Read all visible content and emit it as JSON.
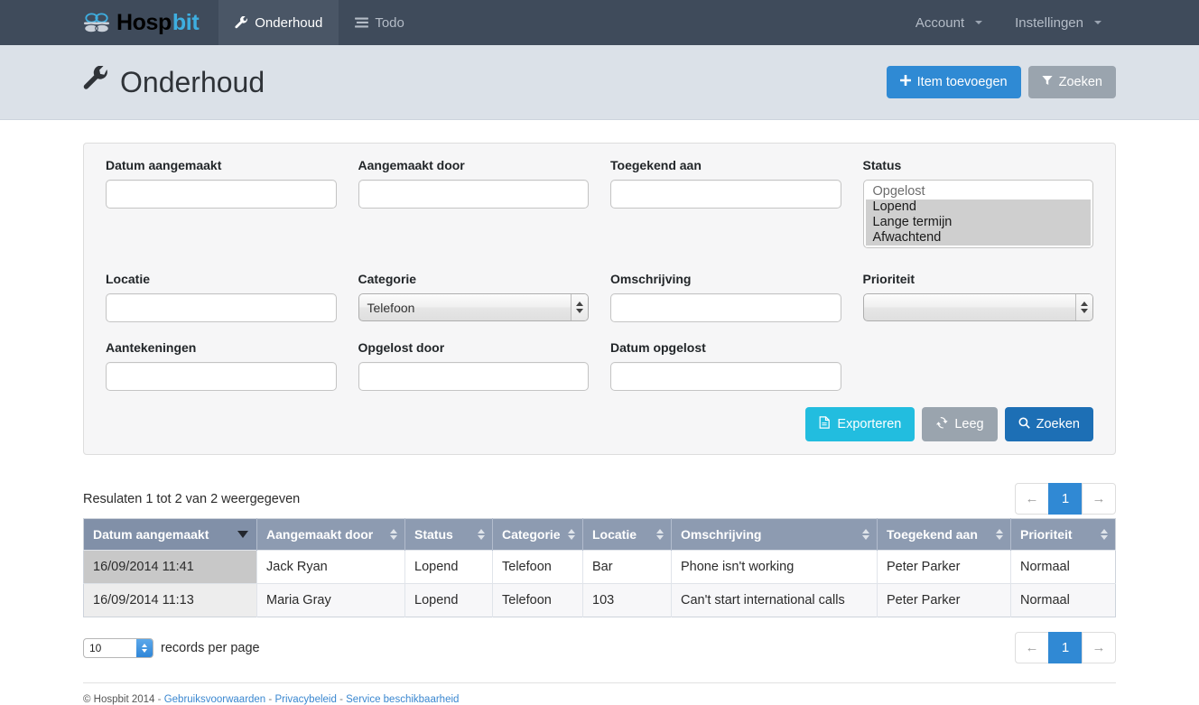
{
  "navbar": {
    "brand": {
      "name_a": "Hosp",
      "name_b": "bit",
      "icon": "hospital-bed-icon"
    },
    "items": [
      {
        "label": "Onderhoud",
        "icon": "wrench-icon",
        "active": true
      },
      {
        "label": "Todo",
        "icon": "list-icon",
        "active": false
      }
    ],
    "right_items": [
      {
        "label": "Account",
        "icon": "caret-down-icon"
      },
      {
        "label": "Instellingen",
        "icon": "caret-down-icon"
      }
    ],
    "bg_color": "#3f4b5b",
    "active_bg_color": "#4a5666"
  },
  "page_header": {
    "title": "Onderhoud",
    "icon": "wrench-icon",
    "add_button": {
      "label": "Item toevoegen",
      "icon": "plus-icon",
      "color": "#2f8ad4"
    },
    "search_button": {
      "label": "Zoeken",
      "icon": "filter-icon",
      "color": "#9aa4ae"
    }
  },
  "filters": {
    "row1": [
      {
        "label": "Datum aangemaakt",
        "value": "",
        "placeholder": "",
        "type": "text",
        "name": "datum-aangemaakt"
      },
      {
        "label": "Aangemaakt door",
        "value": "",
        "placeholder": "",
        "type": "text",
        "name": "aangemaakt-door"
      },
      {
        "label": "Toegekend aan",
        "value": "",
        "placeholder": "",
        "type": "text",
        "name": "toegekend-aan"
      }
    ],
    "status": {
      "label": "Status",
      "type": "multiselect",
      "options": [
        {
          "label": "Opgelost",
          "selected": false
        },
        {
          "label": "Lopend",
          "selected": true
        },
        {
          "label": "Lange termijn",
          "selected": true
        },
        {
          "label": "Afwachtend",
          "selected": true
        }
      ]
    },
    "row2": [
      {
        "label": "Locatie",
        "value": "",
        "type": "text",
        "name": "locatie"
      },
      {
        "label": "Categorie",
        "value": "Telefoon",
        "type": "select",
        "name": "categorie"
      },
      {
        "label": "Omschrijving",
        "value": "",
        "type": "text",
        "name": "omschrijving"
      },
      {
        "label": "Prioriteit",
        "value": "",
        "type": "select",
        "name": "prioriteit"
      }
    ],
    "row3": [
      {
        "label": "Aantekeningen",
        "value": "",
        "type": "text",
        "name": "aantekeningen"
      },
      {
        "label": "Opgelost door",
        "value": "",
        "type": "text",
        "name": "opgelost-door"
      },
      {
        "label": "Datum opgelost",
        "value": "",
        "type": "text",
        "name": "datum-opgelost"
      }
    ],
    "actions": [
      {
        "label": "Exporteren",
        "icon": "pdf-file-icon",
        "color": "#22bddf"
      },
      {
        "label": "Leeg",
        "icon": "refresh-icon",
        "color": "#9aa4ae"
      },
      {
        "label": "Zoeken",
        "icon": "magnifier-icon",
        "color": "#1d6fb5"
      }
    ]
  },
  "results": {
    "summary": "Resulaten 1 tot 2 van 2 weergegeven",
    "pager": {
      "prev": "←",
      "current": "1",
      "next": "→"
    },
    "records_per_page": {
      "value": "10",
      "label": "records per page"
    }
  },
  "table": {
    "columns": [
      {
        "label": "Datum aangemaakt",
        "sort": "desc"
      },
      {
        "label": "Aangemaakt door",
        "sort": "none"
      },
      {
        "label": "Status",
        "sort": "none"
      },
      {
        "label": "Categorie",
        "sort": "none"
      },
      {
        "label": "Locatie",
        "sort": "none"
      },
      {
        "label": "Omschrijving",
        "sort": "none"
      },
      {
        "label": "Toegekend aan",
        "sort": "none"
      },
      {
        "label": "Prioriteit",
        "sort": "none"
      }
    ],
    "rows": [
      [
        "16/09/2014 11:41",
        "Jack Ryan",
        "Lopend",
        "Telefoon",
        "Bar",
        "Phone isn't working",
        "Peter Parker",
        "Normaal"
      ],
      [
        "16/09/2014 11:13",
        "Maria Gray",
        "Lopend",
        "Telefoon",
        "103",
        "Can't start international calls",
        "Peter Parker",
        "Normaal"
      ]
    ]
  },
  "footer": {
    "copyright": "© Hospbit 2014",
    "links": [
      "Gebruiksvoorwaarden",
      "Privacybeleid",
      "Service beschikbaarheid"
    ],
    "separator": "-"
  }
}
